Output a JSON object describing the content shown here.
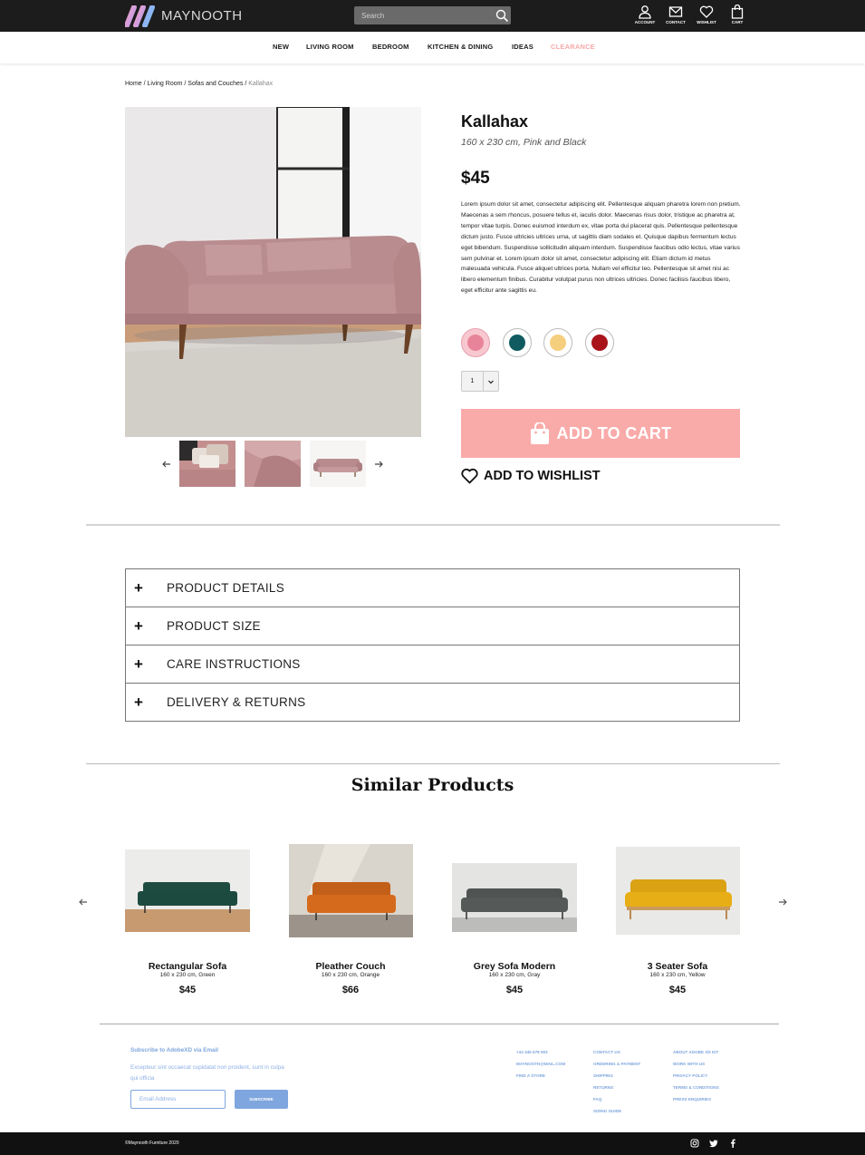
{
  "header": {
    "brand": "MAYNOOTH",
    "search_placeholder": "Search",
    "icons": [
      {
        "label": "ACCOUNT",
        "icon": "account-icon"
      },
      {
        "label": "CONTACT",
        "icon": "mail-icon"
      },
      {
        "label": "WISHLIST",
        "icon": "heart-icon"
      },
      {
        "label": "CART",
        "icon": "bag-icon"
      }
    ]
  },
  "nav": {
    "items": [
      "NEW",
      "LIVING ROOM",
      "BEDROOM",
      "KITCHEN & DINING",
      "IDEAS",
      "CLEARANCE"
    ]
  },
  "breadcrumb": {
    "items": [
      "Home",
      "Living Room",
      "Sofas and Couches"
    ],
    "current": "Kallahax"
  },
  "product": {
    "name": "Kallahax",
    "subtitle": "160 x 230 cm, Pink and Black",
    "price": "$45",
    "description": "Lorem ipsum dolor sit amet, consectetur adipiscing elit. Pellentesque aliquam pharetra lorem non pretium. Maecenas a sem rhoncus, posuere tellus et, iaculis dolor. Maecenas risus dolor, tristique ac pharetra at, tempor vitae turpis. Donec euismod interdum ex, vitae porta dui placerat quis. Pellentesque pellentesque dictum justo. Fusce ultricies ultrices urna, ut sagittis diam sodales et. Quisque dapibus fermentum lectus eget bibendum. Suspendisse sollicitudin aliquam interdum. Suspendisse faucibus odio lectus, vitae varius sem pulvinar et. Lorem ipsum dolor sit amet, consectetur adipiscing elit. Etiam dictum id metus malesuada vehicula. Fusce aliquet ultrices porta. Nullam vel efficitur leo. Pellentesque sit amet nisi ac libero elementum finibus. Curabitur volutpat purus non ultrices ultricies. Donec facilisis faucibus libero, eget efficitur ante sagittis eu.",
    "swatches": [
      {
        "name": "pink",
        "color": "#e8849a",
        "selected": true
      },
      {
        "name": "teal",
        "color": "#0f5b5f",
        "selected": false
      },
      {
        "name": "yellow",
        "color": "#f6cf7e",
        "selected": false
      },
      {
        "name": "red",
        "color": "#a8141a",
        "selected": false
      }
    ],
    "quantity": "1",
    "add_to_cart_label": "ADD TO CART",
    "add_to_wishlist_label": "ADD TO WISHLIST"
  },
  "details": {
    "sections": [
      "PRODUCT DETAILS",
      "PRODUCT SIZE",
      "CARE INSTRUCTIONS",
      "DELIVERY & RETURNS"
    ]
  },
  "similar": {
    "title": "Similar Products",
    "products": [
      {
        "name": "Rectangular Sofa",
        "subtitle": "160 x 230 cm, Green",
        "price": "$45",
        "color": "#1d4a3f"
      },
      {
        "name": "Pleather Couch",
        "subtitle": "160 x 230 cm, Orange",
        "price": "$66",
        "color": "#d56a1c"
      },
      {
        "name": "Grey Sofa Modern",
        "subtitle": "160 x 230 cm, Gray",
        "price": "$45",
        "color": "#555a58"
      },
      {
        "name": "3 Seater Sofa",
        "subtitle": "160 x 230 cm, Yellow",
        "price": "$45",
        "color": "#e7ae16"
      }
    ]
  },
  "footer": {
    "subscribe_title": "Subscribe to AdobeXD via Email",
    "subscribe_text": "Excepteur sint occaecat cupidatat non proident, sunt in culpa qui officia",
    "email_placeholder": "Email Address",
    "subscribe_button": "SUBSCRIBE",
    "col1": [
      "+44 345 678 903",
      "MAYNOOTH@MAIL.COM",
      "FIND A STORE"
    ],
    "col2": [
      "CONTACT US",
      "ORDERING & PAYMENT",
      "SHIPPING",
      "RETURNS",
      "FAQ",
      "SIZING GUIDE"
    ],
    "col3": [
      "ABOUT ADOBE XD KIT",
      "WORK WITH US",
      "PRIVACY POLICY",
      "TERMS & CONDITIONS",
      "PRESS ENQUIRIES"
    ],
    "copyright": "©Maynooth Furniture 2020",
    "social": [
      "instagram-icon",
      "twitter-icon",
      "facebook-icon"
    ]
  }
}
